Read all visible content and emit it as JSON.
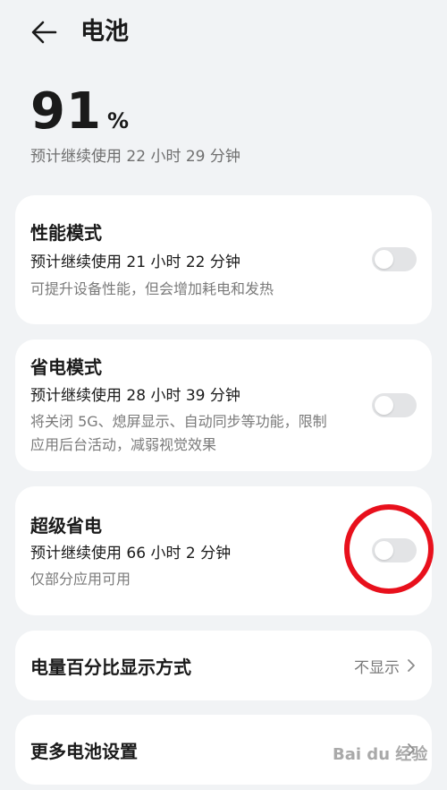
{
  "header": {
    "title": "电池"
  },
  "battery": {
    "percent": "91",
    "unit": "%",
    "estimate": "预计继续使用 22 小时 29 分钟"
  },
  "modes": [
    {
      "title": "性能模式",
      "estimate": "预计继续使用 21 小时 22 分钟",
      "desc": "可提升设备性能，但会增加耗电和发热",
      "enabled": false
    },
    {
      "title": "省电模式",
      "estimate": "预计继续使用 28 小时 39 分钟",
      "desc": "将关闭 5G、熄屏显示、自动同步等功能，限制应用后台活动，减弱视觉效果",
      "enabled": false
    },
    {
      "title": "超级省电",
      "estimate": "预计继续使用 66 小时 2 分钟",
      "desc": "仅部分应用可用",
      "enabled": false
    }
  ],
  "percent_display": {
    "label": "电量百分比显示方式",
    "value": "不显示"
  },
  "more_settings": {
    "label": "更多电池设置"
  },
  "watermark": "Bai du 经验",
  "colors": {
    "background": "#f1f3f5",
    "card": "#ffffff",
    "toggle_off": "#e3e4e6",
    "annotation": "#e8101c"
  }
}
